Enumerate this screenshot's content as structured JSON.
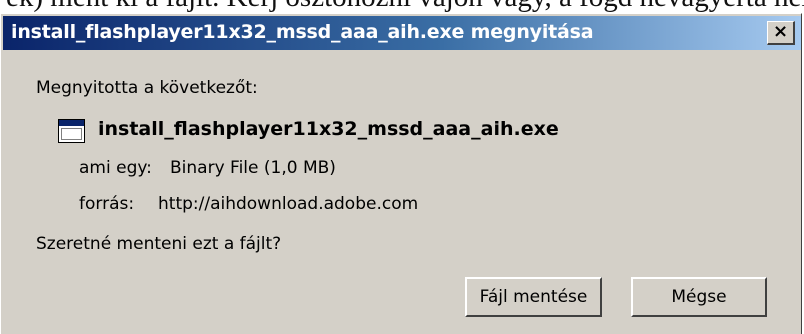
{
  "background_text": "ek) ment ki a fájlt. Kérj ösztönözni vájon vagy, a fogd nevágyerta helyét",
  "dialog": {
    "title": "install_flashplayer11x32_mssd_aaa_aih.exe megnyitása",
    "close_glyph": "×",
    "opened_label": "Megnyitotta a következőt:",
    "filename": "install_flashplayer11x32_mssd_aaa_aih.exe",
    "type_label": "ami egy:",
    "type_value": "Binary File (1,0 MB)",
    "source_label": "forrás:",
    "source_value": "http://aihdownload.adobe.com",
    "question": "Szeretné menteni ezt a fájlt?",
    "save_button": "Fájl mentése",
    "cancel_button": "Mégse"
  },
  "colors": {
    "titlebar_start": "#0a246a",
    "titlebar_end": "#a6caf0",
    "dialog_face": "#d4d0c8"
  },
  "icons": {
    "file_icon": "application-window-icon",
    "close_icon": "close-icon"
  }
}
